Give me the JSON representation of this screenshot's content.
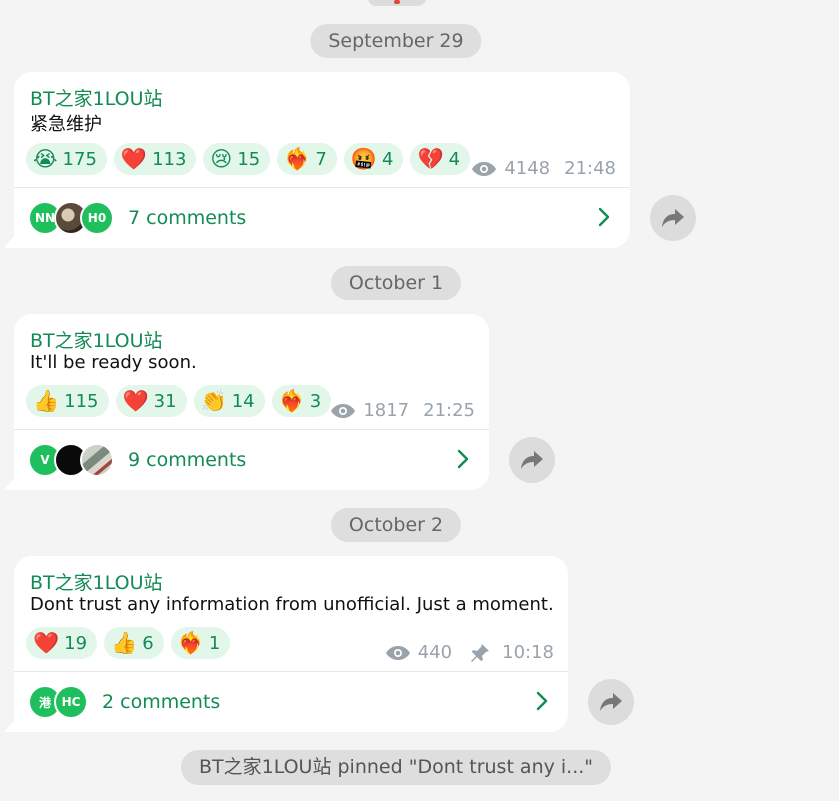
{
  "colors": {
    "accent": "#128c53",
    "reaction_bg": "#e3f6ea",
    "avatar_green": "#1fbf5d"
  },
  "posts": [
    {
      "date": "September 29",
      "author": "BT之家1LOU站",
      "text": "紧急维护",
      "reactions": [
        {
          "emoji": "😭",
          "count": "175"
        },
        {
          "emoji": "❤️",
          "count": "113"
        },
        {
          "emoji": "😢",
          "count": "15"
        },
        {
          "emoji": "❤️‍🔥",
          "count": "7"
        },
        {
          "emoji": "🤬",
          "count": "4"
        },
        {
          "emoji": "💔",
          "count": "4"
        }
      ],
      "views": "4148",
      "time": "21:48",
      "comments": {
        "label": "7 comments",
        "avatars": [
          {
            "initials": "NN",
            "style": "green"
          },
          {
            "initials": "",
            "style": "brown"
          },
          {
            "initials": "H0",
            "style": "green"
          }
        ]
      }
    },
    {
      "date": "October 1",
      "author": "BT之家1LOU站",
      "text": "It'll be ready soon.",
      "reactions": [
        {
          "emoji": "👍",
          "count": "115"
        },
        {
          "emoji": "❤️",
          "count": "31"
        },
        {
          "emoji": "👏",
          "count": "14"
        },
        {
          "emoji": "❤️‍🔥",
          "count": "3"
        }
      ],
      "views": "1817",
      "time": "21:25",
      "comments": {
        "label": "9 comments",
        "avatars": [
          {
            "initials": "V",
            "style": "green"
          },
          {
            "initials": "",
            "style": "black"
          },
          {
            "initials": "",
            "style": "photo"
          }
        ]
      }
    },
    {
      "date": "October 2",
      "author": "BT之家1LOU站",
      "text": "Dont trust any information from unofficial. Just a moment.",
      "reactions": [
        {
          "emoji": "❤️",
          "count": "19"
        },
        {
          "emoji": "👍",
          "count": "6"
        },
        {
          "emoji": "❤️‍🔥",
          "count": "1"
        }
      ],
      "views": "440",
      "time": "10:18",
      "pinned": true,
      "comments": {
        "label": "2 comments",
        "avatars": [
          {
            "initials": "港",
            "style": "green"
          },
          {
            "initials": "HC",
            "style": "green"
          }
        ]
      }
    }
  ],
  "service_message": "BT之家1LOU站 pinned \"Dont trust any i...\""
}
